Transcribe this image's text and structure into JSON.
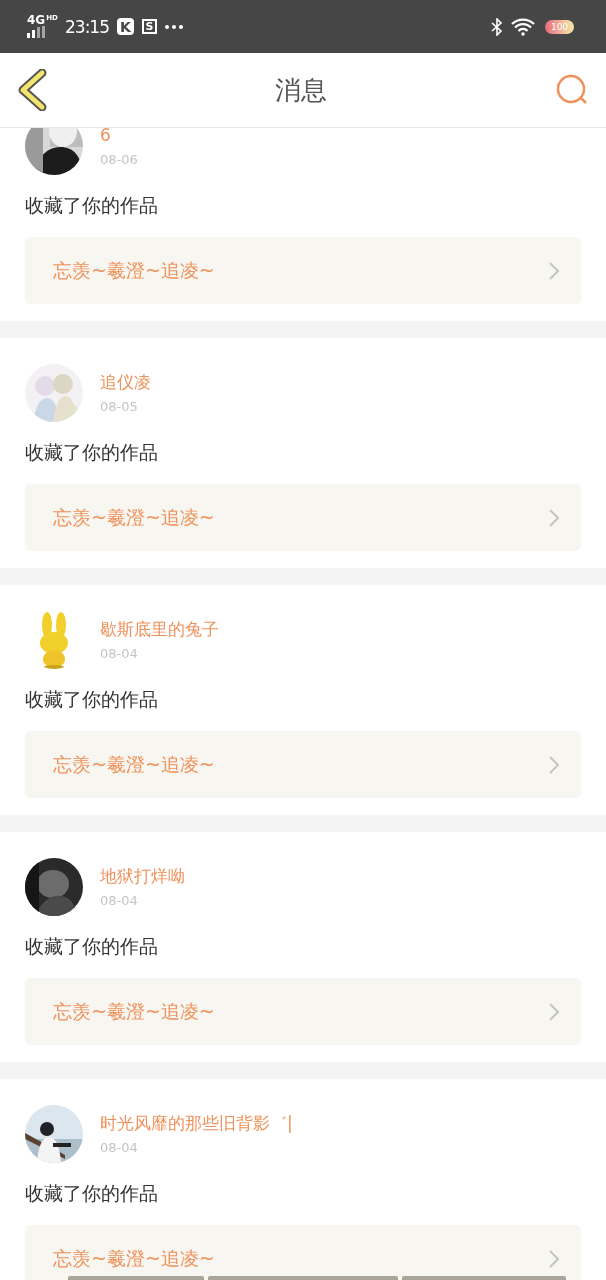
{
  "status_bar": {
    "network": "4G",
    "network_badge": "HD",
    "time": "23:15",
    "app_icons": [
      "K",
      "S"
    ],
    "battery": "100"
  },
  "header": {
    "title": "消息"
  },
  "messages": [
    {
      "name": "6",
      "date": "08-06",
      "action": "收藏了你的作品",
      "work": "忘羡~羲澄~追凌~"
    },
    {
      "name": "追仪凌",
      "date": "08-05",
      "action": "收藏了你的作品",
      "work": "忘羡~羲澄~追凌~"
    },
    {
      "name": "歇斯底里的兔子",
      "date": "08-04",
      "action": "收藏了你的作品",
      "work": "忘羡~羲澄~追凌~"
    },
    {
      "name": "地狱打烊呦",
      "date": "08-04",
      "action": "收藏了你的作品",
      "work": "忘羡~羲澄~追凌~"
    },
    {
      "name": "时光风靡的那些旧背影゛|",
      "date": "08-04",
      "action": "收藏了你的作品",
      "work": "忘羡~羲澄~追凌~"
    }
  ]
}
